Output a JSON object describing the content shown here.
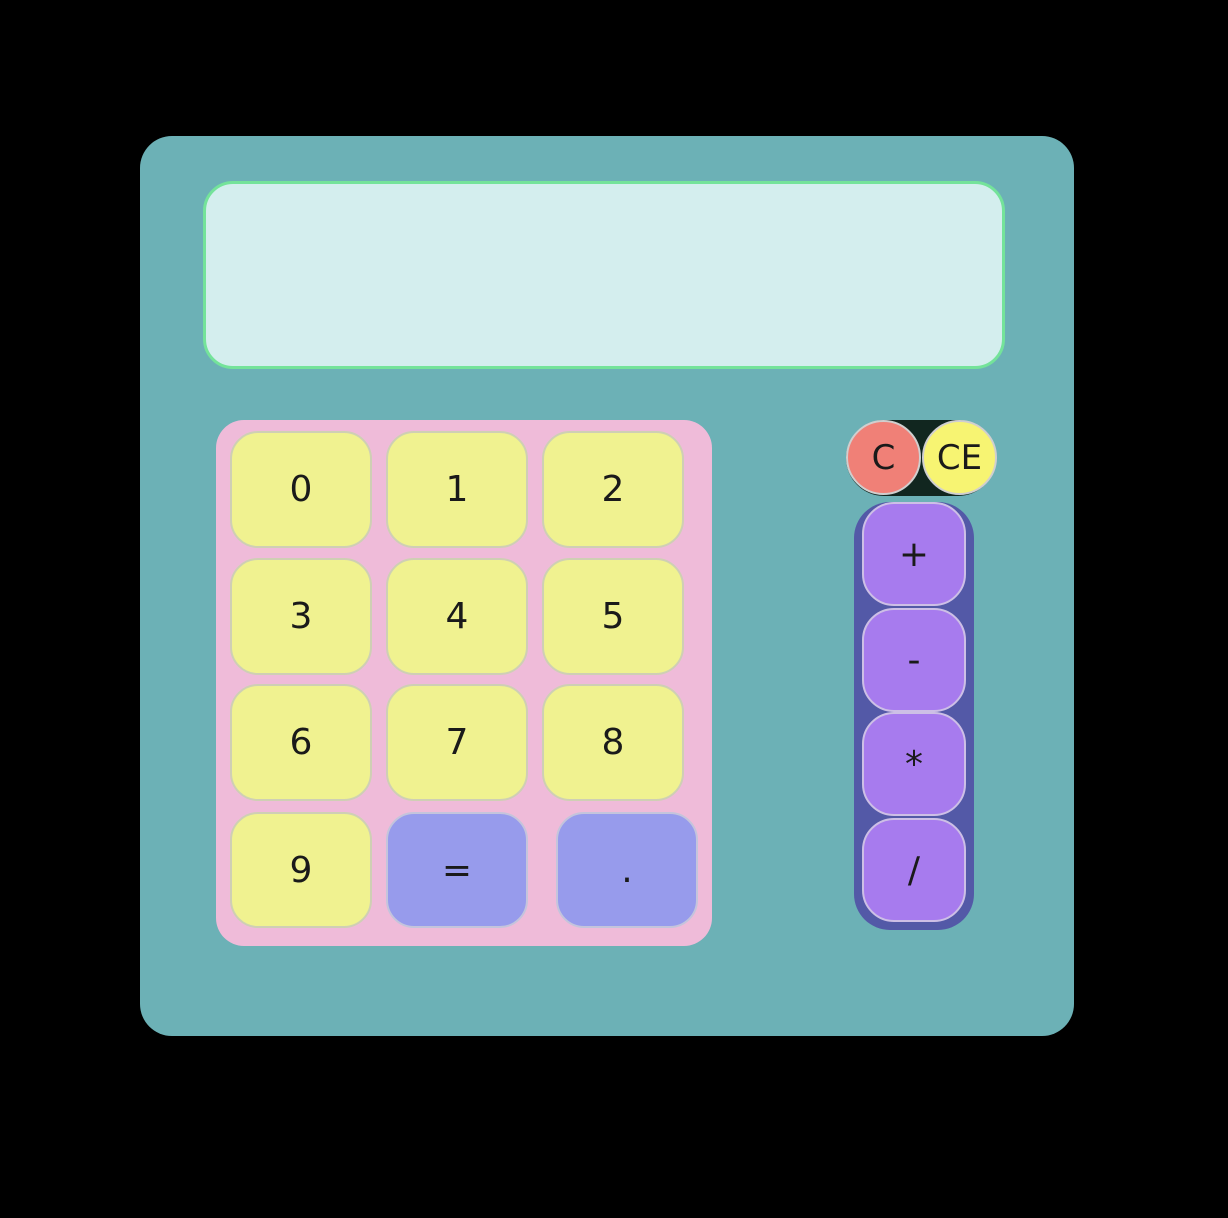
{
  "display": {
    "value": ""
  },
  "keypad": {
    "digits": [
      "0",
      "1",
      "2",
      "3",
      "4",
      "5",
      "6",
      "7",
      "8",
      "9"
    ],
    "equals_label": "=",
    "decimal_label": "."
  },
  "clear": {
    "c_label": "C",
    "ce_label": "CE"
  },
  "operators": [
    "+",
    "-",
    "*",
    "/"
  ],
  "colors": {
    "body": "#6cb1b6",
    "display_bg": "#d4eeee",
    "display_border": "#74e39a",
    "numpad_bg": "#efbbd9",
    "digit_key": "#f0f290",
    "accent_key": "#979bec",
    "clear_key": "#f08077",
    "clear_entry_key": "#f7f472",
    "operator_panel": "#5359a7",
    "operator_key": "#a77bee"
  }
}
